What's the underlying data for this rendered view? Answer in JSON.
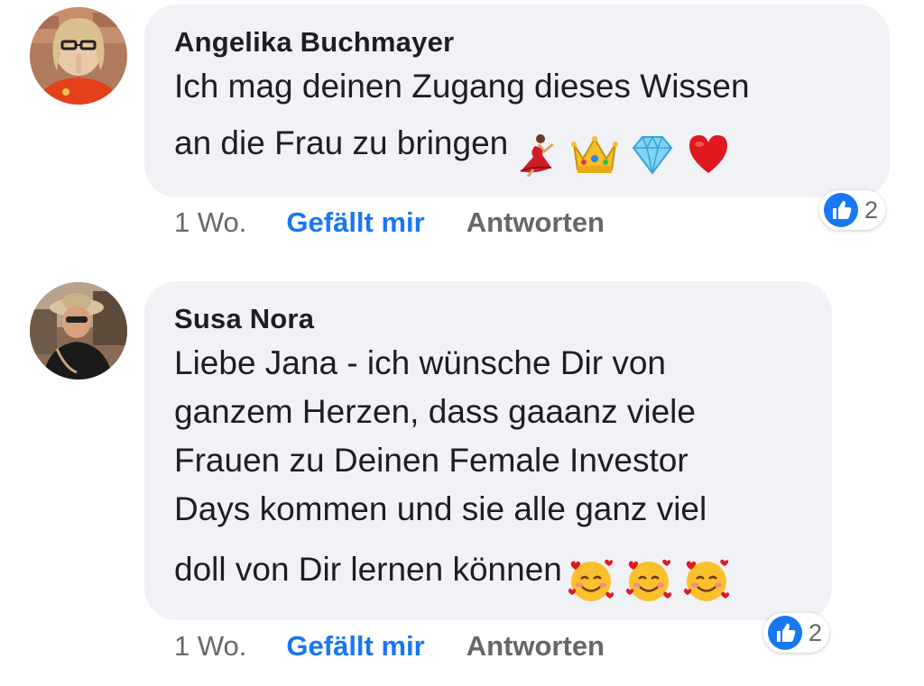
{
  "comments": [
    {
      "author": "Angelika Buchmayer",
      "lines": [
        "Ich mag deinen Zugang dieses Wissen",
        "an die Frau zu bringen"
      ],
      "emojis": [
        "dancer-emoji",
        "crown-emoji",
        "gem-emoji",
        "red-heart-emoji"
      ],
      "time": "1 Wo.",
      "like_label": "Gefällt mir",
      "reply_label": "Antworten",
      "reaction_count": "2",
      "reaction_icon": "thumbs-up-icon"
    },
    {
      "author": "Susa Nora",
      "lines": [
        "Liebe Jana - ich wünsche Dir von",
        "ganzem Herzen, dass gaaanz viele",
        "Frauen zu Deinen Female Investor",
        "Days kommen und sie alle ganz viel",
        "doll von Dir lernen können"
      ],
      "emojis": [
        "smiling-face-with-hearts-emoji",
        "smiling-face-with-hearts-emoji",
        "smiling-face-with-hearts-emoji"
      ],
      "time": "1 Wo.",
      "like_label": "Gefällt mir",
      "reply_label": "Antworten",
      "reaction_count": "2",
      "reaction_icon": "thumbs-up-icon"
    }
  ],
  "colors": {
    "bubble": "#f0f2f5",
    "like_blue": "#1877f2",
    "meta_gray": "#65676b",
    "text": "#1c1e21"
  }
}
